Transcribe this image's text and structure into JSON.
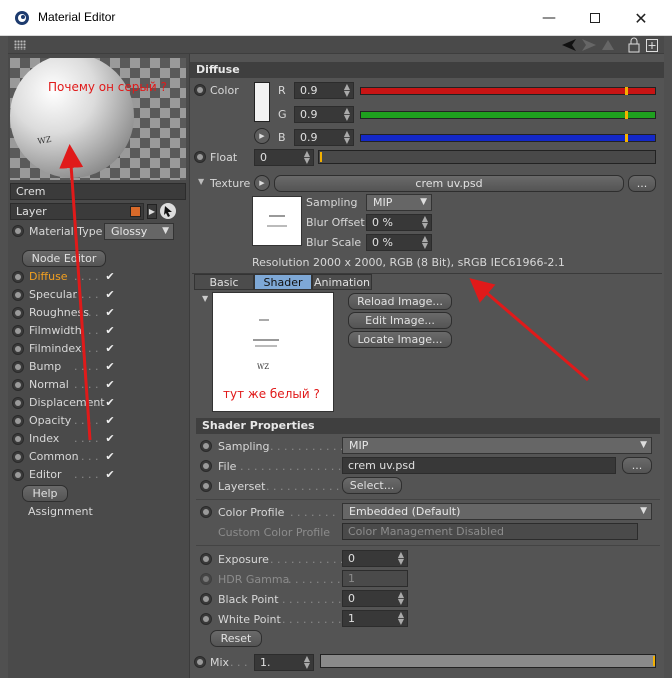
{
  "window": {
    "title": "Material Editor"
  },
  "preview": {
    "annotation": "Почему он серый ?"
  },
  "material": {
    "name": "Crem",
    "layer_label": "Layer",
    "type_label": "Material Type",
    "type_value": "Glossy",
    "node_editor": "Node Editor",
    "help": "Help",
    "assignment": "Assignment",
    "channels": [
      "Diffuse",
      "Specular",
      "Roughness",
      "Filmwidth",
      "Filmindex",
      "Bump",
      "Normal",
      "Displacement",
      "Opacity",
      "Index",
      "Common",
      "Editor"
    ],
    "active_channel": "Diffuse"
  },
  "diffuse": {
    "header": "Diffuse",
    "color_label": "Color",
    "r_label": "R",
    "r_value": "0.9",
    "g_label": "G",
    "g_value": "0.9",
    "b_label": "B",
    "b_value": "0.9",
    "float_label": "Float",
    "float_value": "0",
    "texture_label": "Texture",
    "texture_name": "crem uv.psd",
    "more_button": "...",
    "sampling_label": "Sampling",
    "sampling_value": "MIP",
    "blur_offset_label": "Blur Offset",
    "blur_offset_value": "0 %",
    "blur_scale_label": "Blur Scale",
    "blur_scale_value": "0 %",
    "resolution": "Resolution 2000 x 2000, RGB (8 Bit), sRGB IEC61966-2.1",
    "tabs": [
      "Basic",
      "Shader",
      "Animation"
    ],
    "active_tab": "Shader",
    "reload": "Reload Image...",
    "edit": "Edit Image...",
    "locate": "Locate Image...",
    "thumb_annotation": "тут же белый ?",
    "thumb_text": "WZ"
  },
  "shader": {
    "header": "Shader Properties",
    "sampling_label": "Sampling",
    "sampling_value": "MIP",
    "file_label": "File",
    "file_value": "crem uv.psd",
    "file_more": "...",
    "layerset_label": "Layerset",
    "layerset_button": "Select...",
    "color_profile_label": "Color Profile",
    "color_profile_value": "Embedded (Default)",
    "custom_profile_label": "Custom Color Profile",
    "custom_profile_value": "Color Management Disabled",
    "exposure_label": "Exposure",
    "exposure_value": "0",
    "hdr_gamma_label": "HDR Gamma",
    "hdr_gamma_value": "1",
    "black_point_label": "Black Point",
    "black_point_value": "0",
    "white_point_label": "White Point",
    "white_point_value": "1",
    "reset": "Reset",
    "mix_label": "Mix",
    "mix_value": "1."
  },
  "colors": {
    "red_slider": "#c81414",
    "green_slider": "#1ea01e",
    "blue_slider": "#1428c8",
    "annotation": "#e01a1a",
    "active_tab": "#7ea8d6"
  }
}
